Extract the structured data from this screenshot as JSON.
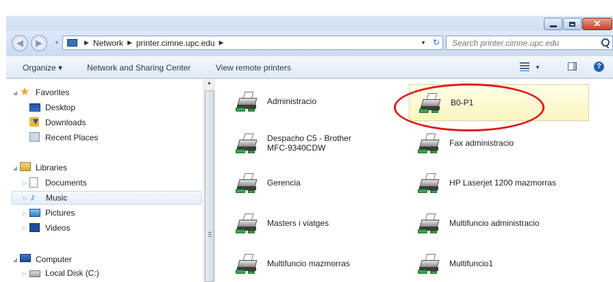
{
  "window": {
    "buttons": {
      "minimize": "minimize",
      "maximize": "maximize",
      "close": "✕"
    }
  },
  "address_bar": {
    "crumbs": [
      "Network",
      "printer.cimne.upc.edu"
    ],
    "search_placeholder": "Search printer.cimne.upc.edu"
  },
  "toolbar": {
    "organize": "Organize ▾",
    "network_sharing": "Network and Sharing Center",
    "view_remote": "View remote printers"
  },
  "nav": {
    "favorites": {
      "label": "Favorites",
      "items": [
        "Desktop",
        "Downloads",
        "Recent Places"
      ]
    },
    "libraries": {
      "label": "Libraries",
      "items": [
        "Documents",
        "Music",
        "Pictures",
        "Videos"
      ]
    },
    "computer": {
      "label": "Computer",
      "items": [
        "Local Disk (C:)"
      ]
    },
    "selected": "Music"
  },
  "printers": [
    {
      "name": "Administracio"
    },
    {
      "name": "B0-P1"
    },
    {
      "name": "Despacho C5 - Brother MFC-9340CDW"
    },
    {
      "name": "Fax administracio"
    },
    {
      "name": "Gerencia"
    },
    {
      "name": "HP Laserjet 1200 mazmorras"
    },
    {
      "name": "Masters i viatges"
    },
    {
      "name": "Multifuncio administracio"
    },
    {
      "name": "Multifuncio mazmorras"
    },
    {
      "name": "Multifuncio1"
    }
  ],
  "selected_printer": "B0-P1",
  "colors": {
    "highlight_ring": "#e01b1b",
    "selection": "#fbf6c0"
  }
}
